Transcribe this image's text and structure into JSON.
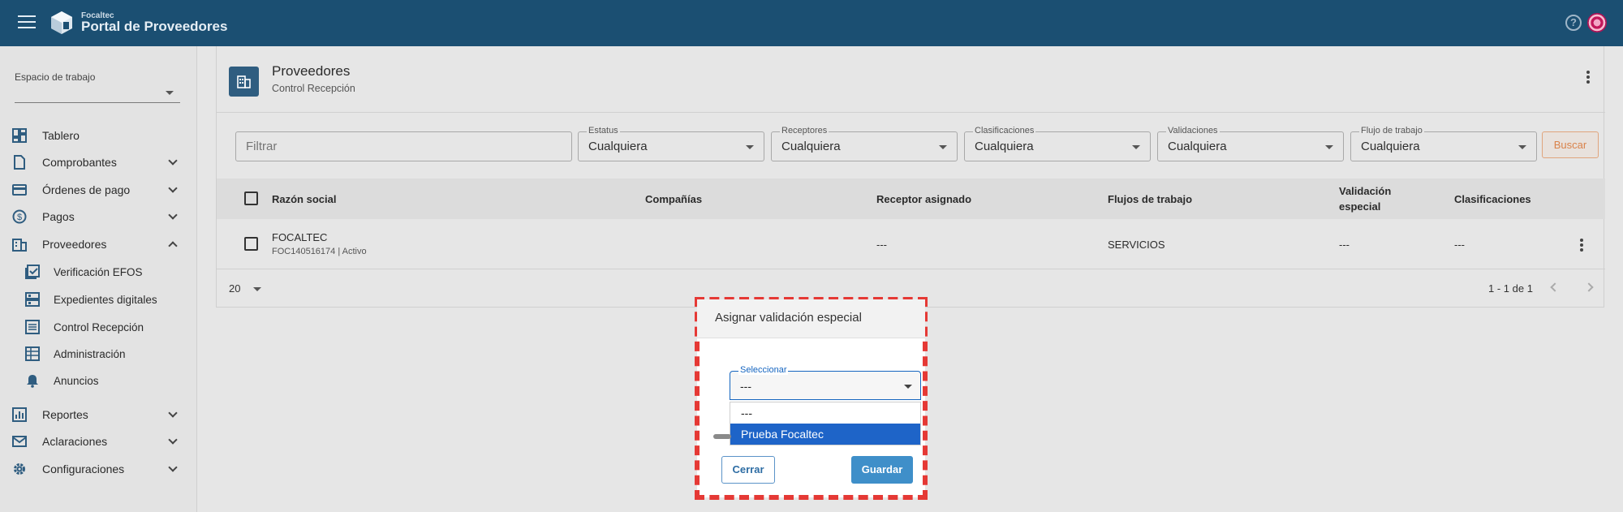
{
  "app": {
    "brand_small": "Focaltec",
    "brand_title": "Portal de Proveedores"
  },
  "header": {
    "help_symbol": "?"
  },
  "sidebar": {
    "workspace_label": "Espacio de trabajo",
    "workspace_value": "",
    "items": [
      {
        "label": "Tablero",
        "icon": "dashboard-icon"
      },
      {
        "label": "Comprobantes",
        "icon": "document-icon"
      },
      {
        "label": "Órdenes de pago",
        "icon": "credit-card-icon"
      },
      {
        "label": "Pagos",
        "icon": "dollar-circle-icon"
      },
      {
        "label": "Proveedores",
        "icon": "building-icon"
      },
      {
        "label": "Reportes",
        "icon": "chart-icon"
      },
      {
        "label": "Aclaraciones",
        "icon": "mail-icon"
      },
      {
        "label": "Configuraciones",
        "icon": "gear-icon"
      }
    ],
    "sub_items": [
      {
        "label": "Verificación EFOS",
        "icon": "check-box-icon"
      },
      {
        "label": "Expedientes digitales",
        "icon": "folder-grid-icon"
      },
      {
        "label": "Control Recepción",
        "icon": "list-icon"
      },
      {
        "label": "Administración",
        "icon": "table-icon"
      },
      {
        "label": "Anuncios",
        "icon": "bell-icon"
      }
    ]
  },
  "page": {
    "title": "Proveedores",
    "subtitle": "Control Recepción"
  },
  "filters": {
    "search_placeholder": "Filtrar",
    "selects": [
      {
        "label": "Estatus",
        "value": "Cualquiera"
      },
      {
        "label": "Receptores",
        "value": "Cualquiera"
      },
      {
        "label": "Clasificaciones",
        "value": "Cualquiera"
      },
      {
        "label": "Validaciones",
        "value": "Cualquiera"
      },
      {
        "label": "Flujo de trabajo",
        "value": "Cualquiera"
      }
    ],
    "search_button": "Buscar"
  },
  "table": {
    "columns": [
      "Razón social",
      "Compañías",
      "Receptor asignado",
      "Flujos de trabajo",
      "Validación",
      "especial",
      "Clasificaciones"
    ],
    "rows": [
      {
        "name": "FOCALTEC",
        "meta": "FOC140516174 | Activo",
        "companies": "",
        "receiver": "---",
        "workflows": "SERVICIOS",
        "special_validation": "---",
        "classifications": "---"
      }
    ]
  },
  "pagination": {
    "page_size": "20",
    "range": "1 - 1 de 1"
  },
  "dialog": {
    "title": "Asignar validación especial",
    "field_label": "Seleccionar",
    "field_value": "---",
    "options": [
      "---",
      "Prueba Focaltec"
    ],
    "selected_option": "Prueba Focaltec",
    "close_label": "Cerrar",
    "save_label": "Guardar"
  },
  "colors": {
    "topbar": "#1b4f72",
    "accent": "#1e64c8",
    "dialog_highlight": "#e53935",
    "search_button": "#d9824a"
  }
}
